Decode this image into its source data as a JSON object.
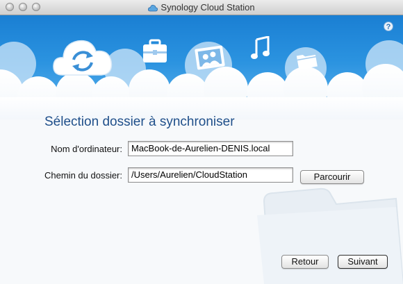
{
  "window": {
    "title": "Synology Cloud Station"
  },
  "header": {
    "icons": [
      "sync-cloud-icon",
      "briefcase-icon",
      "photo-icon",
      "music-note-icon",
      "folder-icon"
    ],
    "help_label": "?"
  },
  "main": {
    "heading": "Sélection dossier à synchroniser",
    "computer_name_label": "Nom d'ordinateur:",
    "computer_name_value": "MacBook-de-Aurelien-DENIS.local",
    "folder_path_label": "Chemin du dossier:",
    "folder_path_value": "/Users/Aurelien/CloudStation",
    "browse_button": "Parcourir"
  },
  "footer": {
    "back_button": "Retour",
    "next_button": "Suivant"
  },
  "colors": {
    "sky_top": "#1a7fd3",
    "heading": "#1f4f8a"
  }
}
